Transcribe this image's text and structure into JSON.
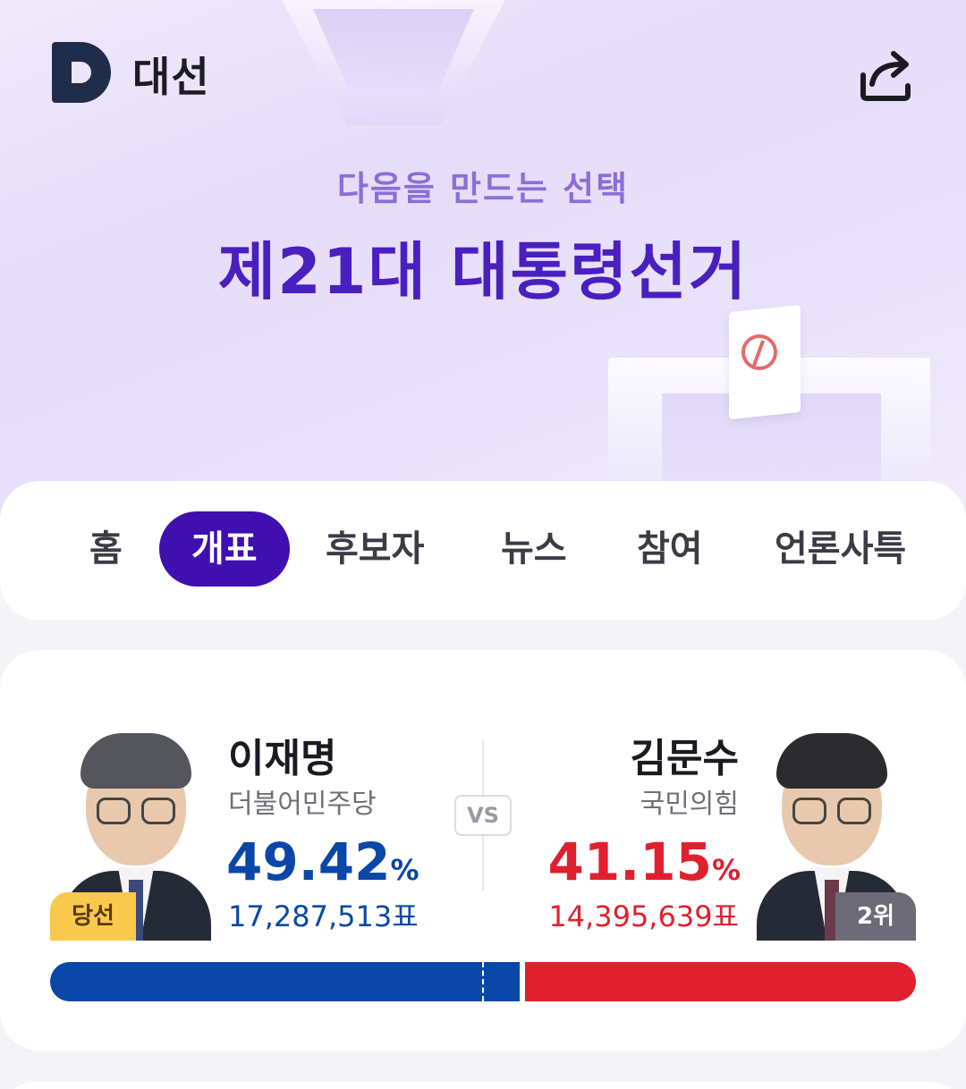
{
  "app": {
    "logo_text": "대선"
  },
  "hero": {
    "subtitle": "다음을 만드는 선택",
    "title": "제21대 대통령선거"
  },
  "tabs": [
    {
      "label": "홈",
      "active": false
    },
    {
      "label": "개표",
      "active": true
    },
    {
      "label": "후보자",
      "active": false
    },
    {
      "label": "뉴스",
      "active": false
    },
    {
      "label": "참여",
      "active": false
    },
    {
      "label": "언론사특",
      "active": false
    }
  ],
  "result": {
    "vs_label": "VS",
    "candidates": [
      {
        "name": "이재명",
        "party": "더불어민주당",
        "percent": "49.42",
        "percent_unit": "%",
        "votes": "17,287,513표",
        "badge": "당선",
        "color": "#0b47a8"
      },
      {
        "name": "김문수",
        "party": "국민의힘",
        "percent": "41.15",
        "percent_unit": "%",
        "votes": "14,395,639표",
        "badge": "2위",
        "color": "#e0202f"
      }
    ]
  },
  "icons": {
    "logo": "daum-d-logo-icon",
    "share": "share-icon"
  },
  "colors": {
    "accent": "#3f0fb0",
    "hero_title": "#4a1fbf",
    "hero_subtitle": "#8b6fd6",
    "winner": "#0b47a8",
    "runner_up": "#e0202f",
    "winner_badge": "#f9c94e"
  }
}
